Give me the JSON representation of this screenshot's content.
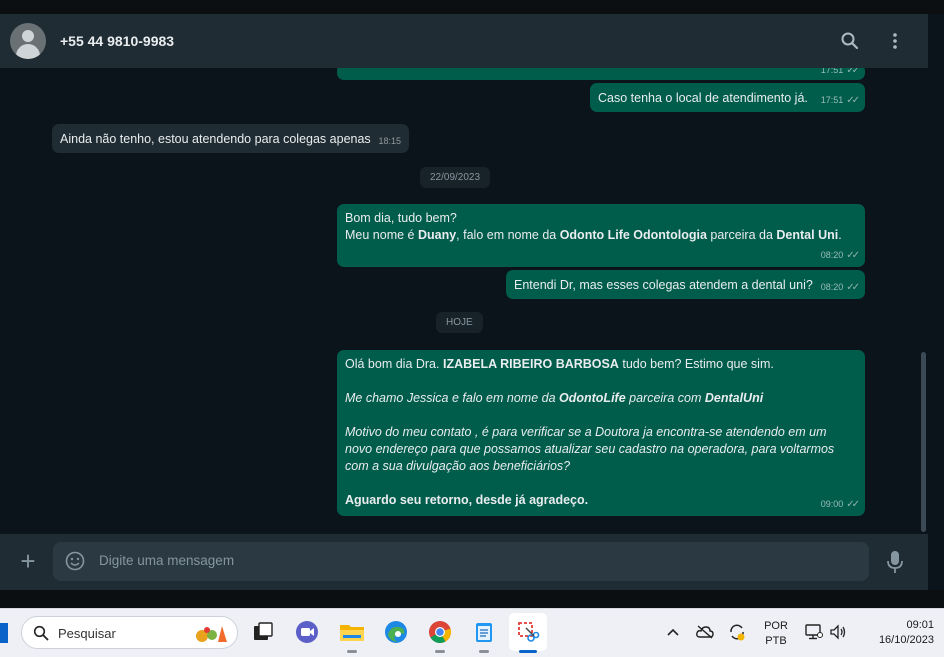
{
  "header": {
    "contact_name": "+55 44 9810-9983"
  },
  "messages": {
    "m0": {
      "time": "17:51"
    },
    "m1": {
      "text": "Caso tenha o local de atendimento já.",
      "time": "17:51"
    },
    "m2": {
      "text": "Ainda não tenho, estou atendendo para colegas apenas",
      "time": "18:15"
    },
    "date1": "22/09/2023",
    "m3": {
      "l1": "Bom dia, tudo bem?",
      "l2a": "Meu nome é ",
      "l2b": "Duany",
      "l2c": ", falo em nome da ",
      "l2d": "Odonto Life Odontologia",
      "l2e": " parceira da ",
      "l2f": "Dental Uni",
      "l2g": ".",
      "time": "08:20"
    },
    "m4": {
      "text": "Entendi Dr, mas esses colegas atendem a dental uni?",
      "time": "08:20"
    },
    "date2": "HOJE",
    "m5": {
      "p1a": "Olá bom dia Dra. ",
      "p1b": "IZABELA RIBEIRO BARBOSA",
      "p1c": " tudo bem? Estimo que sim.",
      "p2a": "Me chamo Jessica e falo em nome da ",
      "p2b": "OdontoLife",
      "p2c": " parceira com ",
      "p2d": "DentalUni",
      "p3": "Motivo do meu contato , é para verificar se a Doutora ja encontra-se atendendo em um novo endereço para que possamos atualizar seu cadastro na operadora, para voltarmos com a sua divulgação aos beneficiários?",
      "p4": "Aguardo seu retorno, desde já agradeço.",
      "time": "09:00"
    }
  },
  "composer": {
    "placeholder": "Digite uma mensagem"
  },
  "taskbar": {
    "search_label": "Pesquisar",
    "lang_top": "POR",
    "lang_bottom": "PTB",
    "clock_time": "09:01",
    "clock_date": "16/10/2023"
  },
  "colors": {
    "outgoing_bubble": "#005c4b",
    "incoming_bubble": "#202c33",
    "chat_bg": "#0b141a"
  }
}
